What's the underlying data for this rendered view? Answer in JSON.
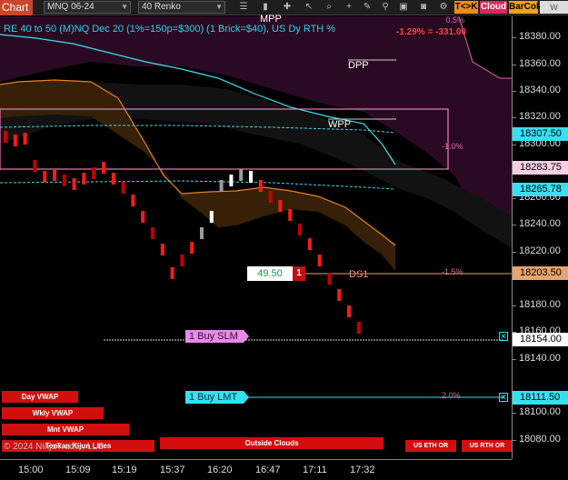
{
  "toolbar": {
    "chart_label": "Chart",
    "instrument": "MNQ 06-24",
    "bar_type": "40 Renko",
    "btn_trade": "T<>K",
    "btn_cloud": "Cloud",
    "btn_barcol": "BarCol",
    "btn_www": "W VWA",
    "icons": [
      "list-icon",
      "bar-icon",
      "crosshair-icon",
      "cursor-icon",
      "zoom-icon",
      "plus-icon",
      "draw-icon",
      "pin-icon",
      "lock-icon",
      "camera-icon",
      "gear-icon"
    ]
  },
  "chart": {
    "title": "RE 40 to 50 (M)NQ Dec 20 (1%=150p=$300) (1 Brick=$40), US Dy RTH %",
    "pnl": "-1.29% = -331.00",
    "pct_top": "0.5%",
    "levels": {
      "mpp": "MPP",
      "dpp": "DPP",
      "wpp": "WPP",
      "ds1": "DS1"
    },
    "pct_labels": [
      "-1.0%",
      "-1.5%",
      "2.0%"
    ],
    "position": {
      "price": "49.50",
      "qty": "1"
    },
    "orders": {
      "slm": "1 Buy SLM",
      "lmt": "1 Buy LMT"
    },
    "close_mark": "✕",
    "red_buttons": [
      "Day VWAP",
      "Wkly VWAP",
      "Mnt VWAP",
      "Outside Clouds",
      "US ETH OR",
      "US RTH OR"
    ],
    "copyright": "© 2024 NinjaTrader, LLC",
    "overlay": "Tenkan Kijun Lines",
    "colors": {
      "cyan": "#36e0f0",
      "orange": "#e8821e",
      "magenta": "#d86ba6",
      "red": "#d20f0f"
    },
    "bricks": [
      [
        0,
        1
      ],
      [
        1,
        1
      ],
      [
        2,
        1
      ],
      [
        3,
        0
      ],
      [
        4,
        0
      ],
      [
        5,
        0
      ],
      [
        6,
        1
      ],
      [
        7,
        1
      ],
      [
        8,
        1
      ],
      [
        9,
        1
      ],
      [
        10,
        1
      ],
      [
        11,
        1
      ],
      [
        12,
        1
      ],
      [
        13,
        1
      ],
      [
        14,
        1
      ],
      [
        15,
        1
      ],
      [
        16,
        1
      ],
      [
        17,
        0
      ],
      [
        18,
        0
      ],
      [
        19,
        0
      ],
      [
        20,
        0
      ],
      [
        21,
        1
      ],
      [
        22,
        1
      ],
      [
        23,
        1
      ],
      [
        24,
        1
      ],
      [
        25,
        1
      ],
      [
        26,
        1
      ],
      [
        27,
        1
      ],
      [
        28,
        1
      ],
      [
        29,
        1
      ],
      [
        30,
        1
      ],
      [
        31,
        1
      ],
      [
        32,
        1
      ],
      [
        33,
        1
      ],
      [
        34,
        1
      ],
      [
        35,
        1
      ],
      [
        36,
        1
      ]
    ]
  },
  "price_axis": {
    "ticks": [
      "18380.00",
      "18360.00",
      "18340.00",
      "18320.00",
      "18300.00",
      "18260.00",
      "18240.00",
      "18220.00",
      "18180.00",
      "18160.00",
      "18140.00",
      "18100.00",
      "18080.00"
    ],
    "badges": [
      {
        "label": "18307.50",
        "kind": "cyan"
      },
      {
        "label": "18283.75",
        "kind": "magenta"
      },
      {
        "label": "18265.78",
        "kind": "cyan"
      },
      {
        "label": "18203.50",
        "kind": "orange"
      },
      {
        "label": "18154.00",
        "kind": "white"
      },
      {
        "label": "18111.50",
        "kind": "cyan"
      }
    ]
  },
  "time_axis": {
    "ticks": [
      "15:00",
      "15:09",
      "15:19",
      "15:37",
      "16:20",
      "16:47",
      "17:11",
      "17:32"
    ]
  }
}
